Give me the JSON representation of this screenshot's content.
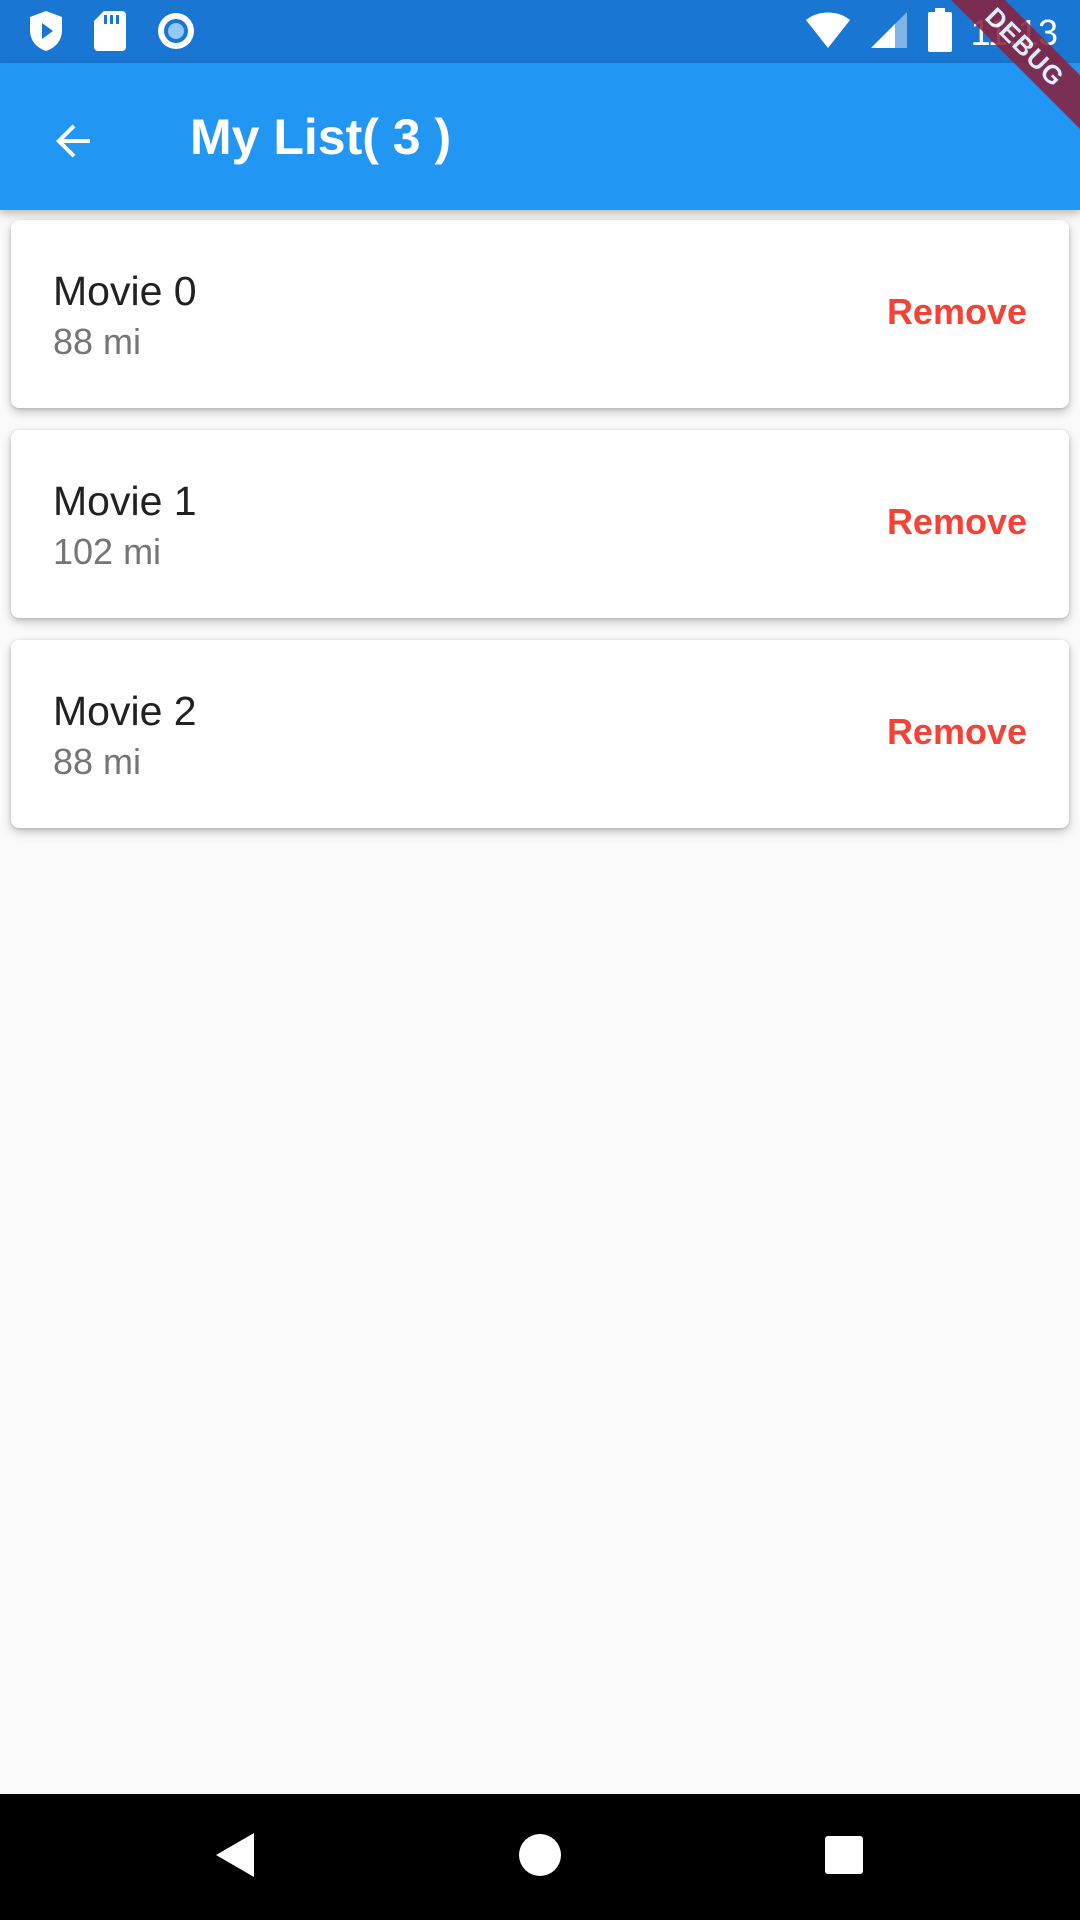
{
  "status_bar": {
    "time": "11:13",
    "left_icons": [
      "play-protect-icon",
      "sd-card-icon",
      "circle-record-icon"
    ],
    "right_icons": [
      "wifi-icon",
      "signal-icon",
      "battery-icon"
    ]
  },
  "debug_banner": "DEBUG",
  "app_bar": {
    "title": "My List( 3 )",
    "back_icon": "arrow-back-icon"
  },
  "items": [
    {
      "title": "Movie 0",
      "subtitle": "88 mi",
      "action": "Remove"
    },
    {
      "title": "Movie 1",
      "subtitle": "102 mi",
      "action": "Remove"
    },
    {
      "title": "Movie 2",
      "subtitle": "88 mi",
      "action": "Remove"
    }
  ],
  "nav_bar": {
    "buttons": [
      "back-triangle-icon",
      "home-circle-icon",
      "recents-square-icon"
    ]
  },
  "colors": {
    "primary": "#2196f3",
    "status_bar": "#1976d2",
    "remove": "#f44336",
    "background": "#fafafa"
  }
}
